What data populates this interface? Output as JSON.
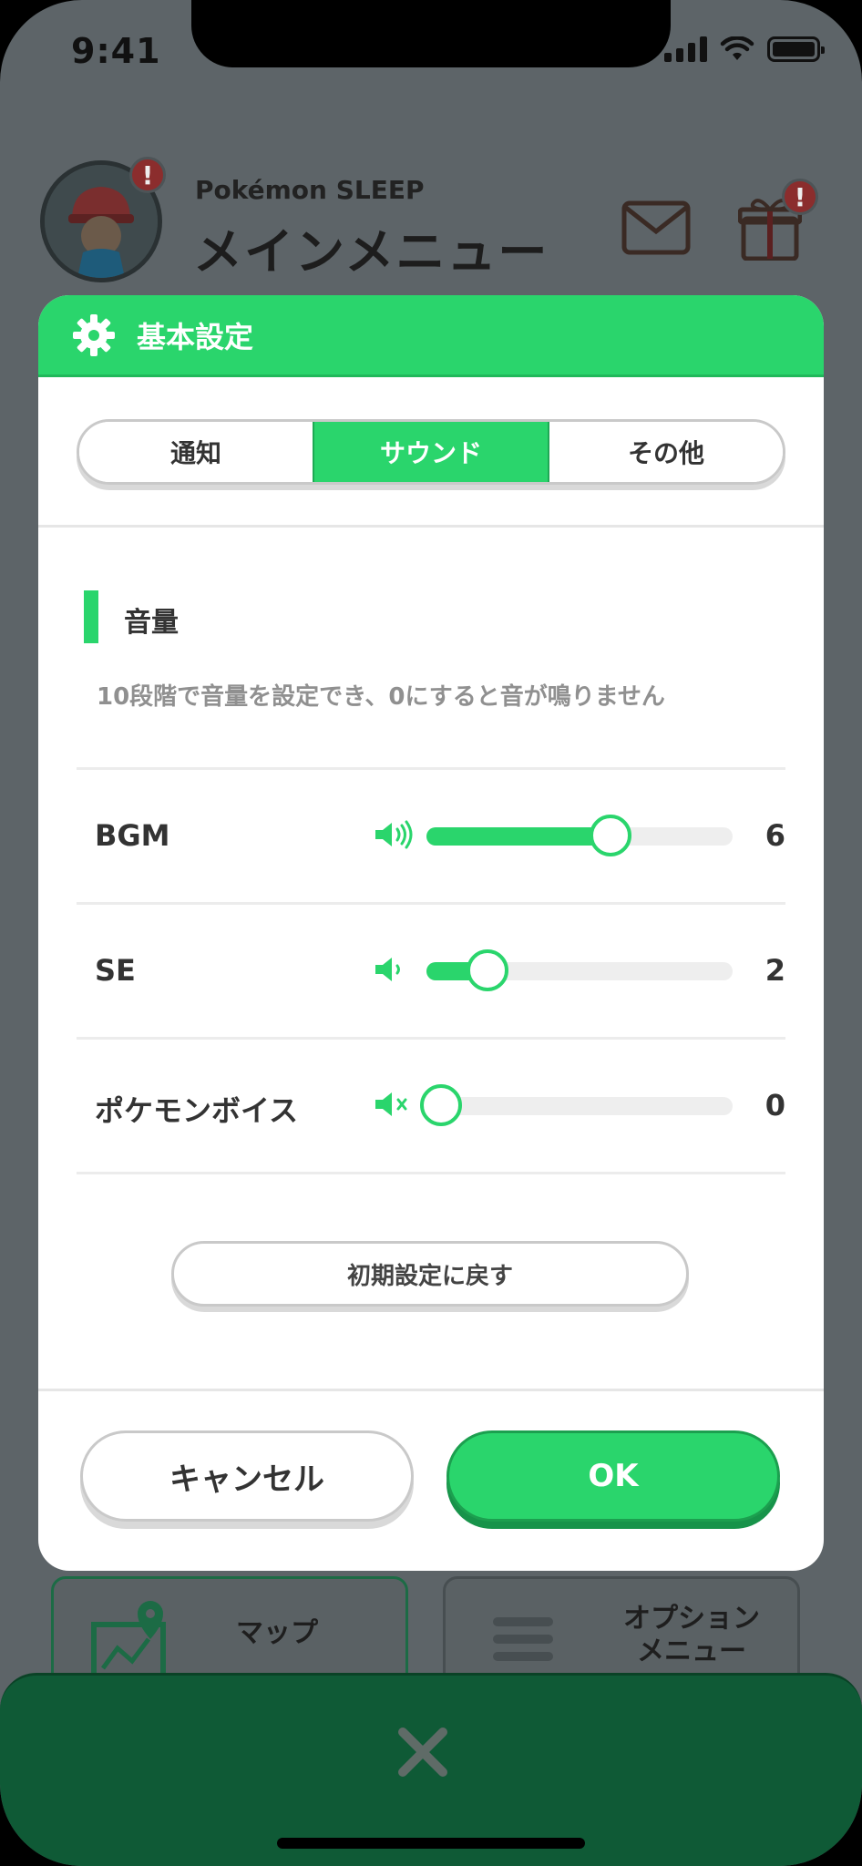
{
  "status_bar": {
    "time": "9:41"
  },
  "header": {
    "brand": "Pokémon SLEEP",
    "title": "メインメニュー",
    "badge_mark": "!"
  },
  "modal": {
    "title": "基本設定",
    "tabs": [
      {
        "label": "通知",
        "active": false
      },
      {
        "label": "サウンド",
        "active": true
      },
      {
        "label": "その他",
        "active": false
      }
    ],
    "section_title": "音量",
    "section_desc": "10段階で音量を設定でき、0にすると音が鳴りません",
    "volume_max": 10,
    "rows": [
      {
        "label": "BGM",
        "value": "6",
        "level": 6,
        "icon": "speaker-loud-icon"
      },
      {
        "label": "SE",
        "value": "2",
        "level": 2,
        "icon": "speaker-low-icon"
      },
      {
        "label": "ポケモンボイス",
        "value": "0",
        "level": 0,
        "icon": "speaker-mute-icon"
      }
    ],
    "reset_label": "初期設定に戻す",
    "cancel_label": "キャンセル",
    "ok_label": "OK"
  },
  "background_cards": {
    "map_label": "マップ",
    "option_label_1": "オプション",
    "option_label_2": "メニュー"
  },
  "colors": {
    "accent": "#2ad56c",
    "bottom_bar": "#0f5a36",
    "overlay": "#5d6468"
  }
}
